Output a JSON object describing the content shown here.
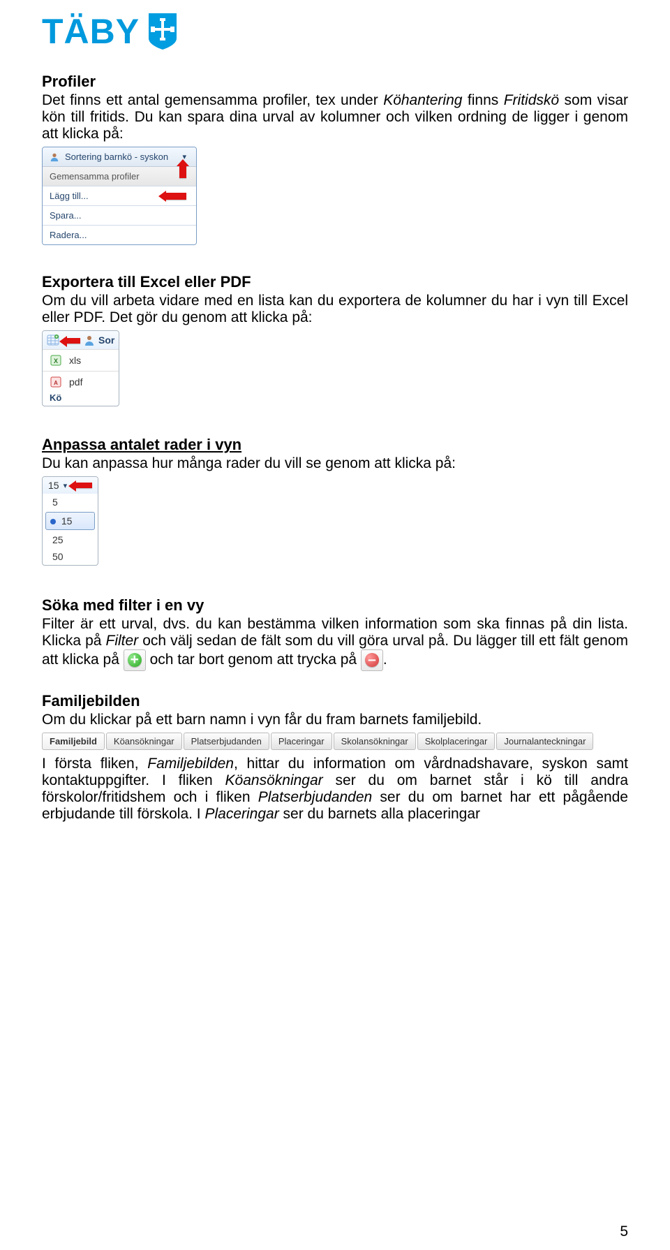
{
  "logo": {
    "text": "TÄBY",
    "icon_name": "taby-shield-icon"
  },
  "sections": {
    "profiler": {
      "title": "Profiler",
      "body": "Det finns ett antal gemensamma profiler, tex under Köhantering finns Fritidskö som visar kön till fritids. Du kan spara dina urval av kolumner och vilken ordning de ligger i genom att klicka på:"
    },
    "export": {
      "title": "Exportera till Excel eller PDF",
      "body": "Om du vill arbeta vidare med en lista kan du exportera de kolumner du har i vyn till Excel eller PDF. Det gör du genom att klicka på:"
    },
    "rows": {
      "title": "Anpassa antalet rader i vyn",
      "body": "Du kan anpassa hur många rader du vill se genom att klicka på:"
    },
    "filter": {
      "title": "Söka med filter i en vy",
      "body_pre": "Filter är ett urval, dvs. du kan bestämma vilken information som ska finnas på din lista. Klicka på ",
      "body_filter_word": "Filter",
      "body_mid": " och välj sedan de fält som du vill göra urval på. Du lägger till ett fält genom att klicka på ",
      "body_mid2": " och tar bort genom att trycka på ",
      "body_end": "."
    },
    "familjebilden": {
      "title": "Familjebilden",
      "body1": "Om du klickar på ett barn namn i vyn får du fram barnets familjebild.",
      "body2_a": "I första fliken, ",
      "body2_b": "Familjebilden",
      "body2_c": ", hittar du information om vårdnadshavare, syskon samt kontaktuppgifter. I fliken ",
      "body2_d": "Köansökningar",
      "body2_e": " ser du om barnet står i kö till andra förskolor/fritidshem och i fliken ",
      "body2_f": "Platserbjudanden",
      "body2_g": " ser du om barnet har ett pågående erbjudande till förskola. I ",
      "body2_h": "Placeringar",
      "body2_i": " ser du barnets alla placeringar"
    }
  },
  "profile_menu": {
    "header": "Sortering barnkö - syskon",
    "items": [
      "Gemensamma profiler",
      "Lägg till...",
      "Spara...",
      "Radera..."
    ]
  },
  "export_menu": {
    "top_label": "Sor",
    "items": [
      "xls",
      "pdf"
    ],
    "bottom_label": "Kö"
  },
  "rows_menu": {
    "current": "15",
    "options": [
      "5",
      "15",
      "25",
      "50"
    ]
  },
  "tabs": [
    "Familjebild",
    "Köansökningar",
    "Platserbjudanden",
    "Placeringar",
    "Skolansökningar",
    "Skolplaceringar",
    "Journalanteckningar"
  ],
  "page_number": "5"
}
